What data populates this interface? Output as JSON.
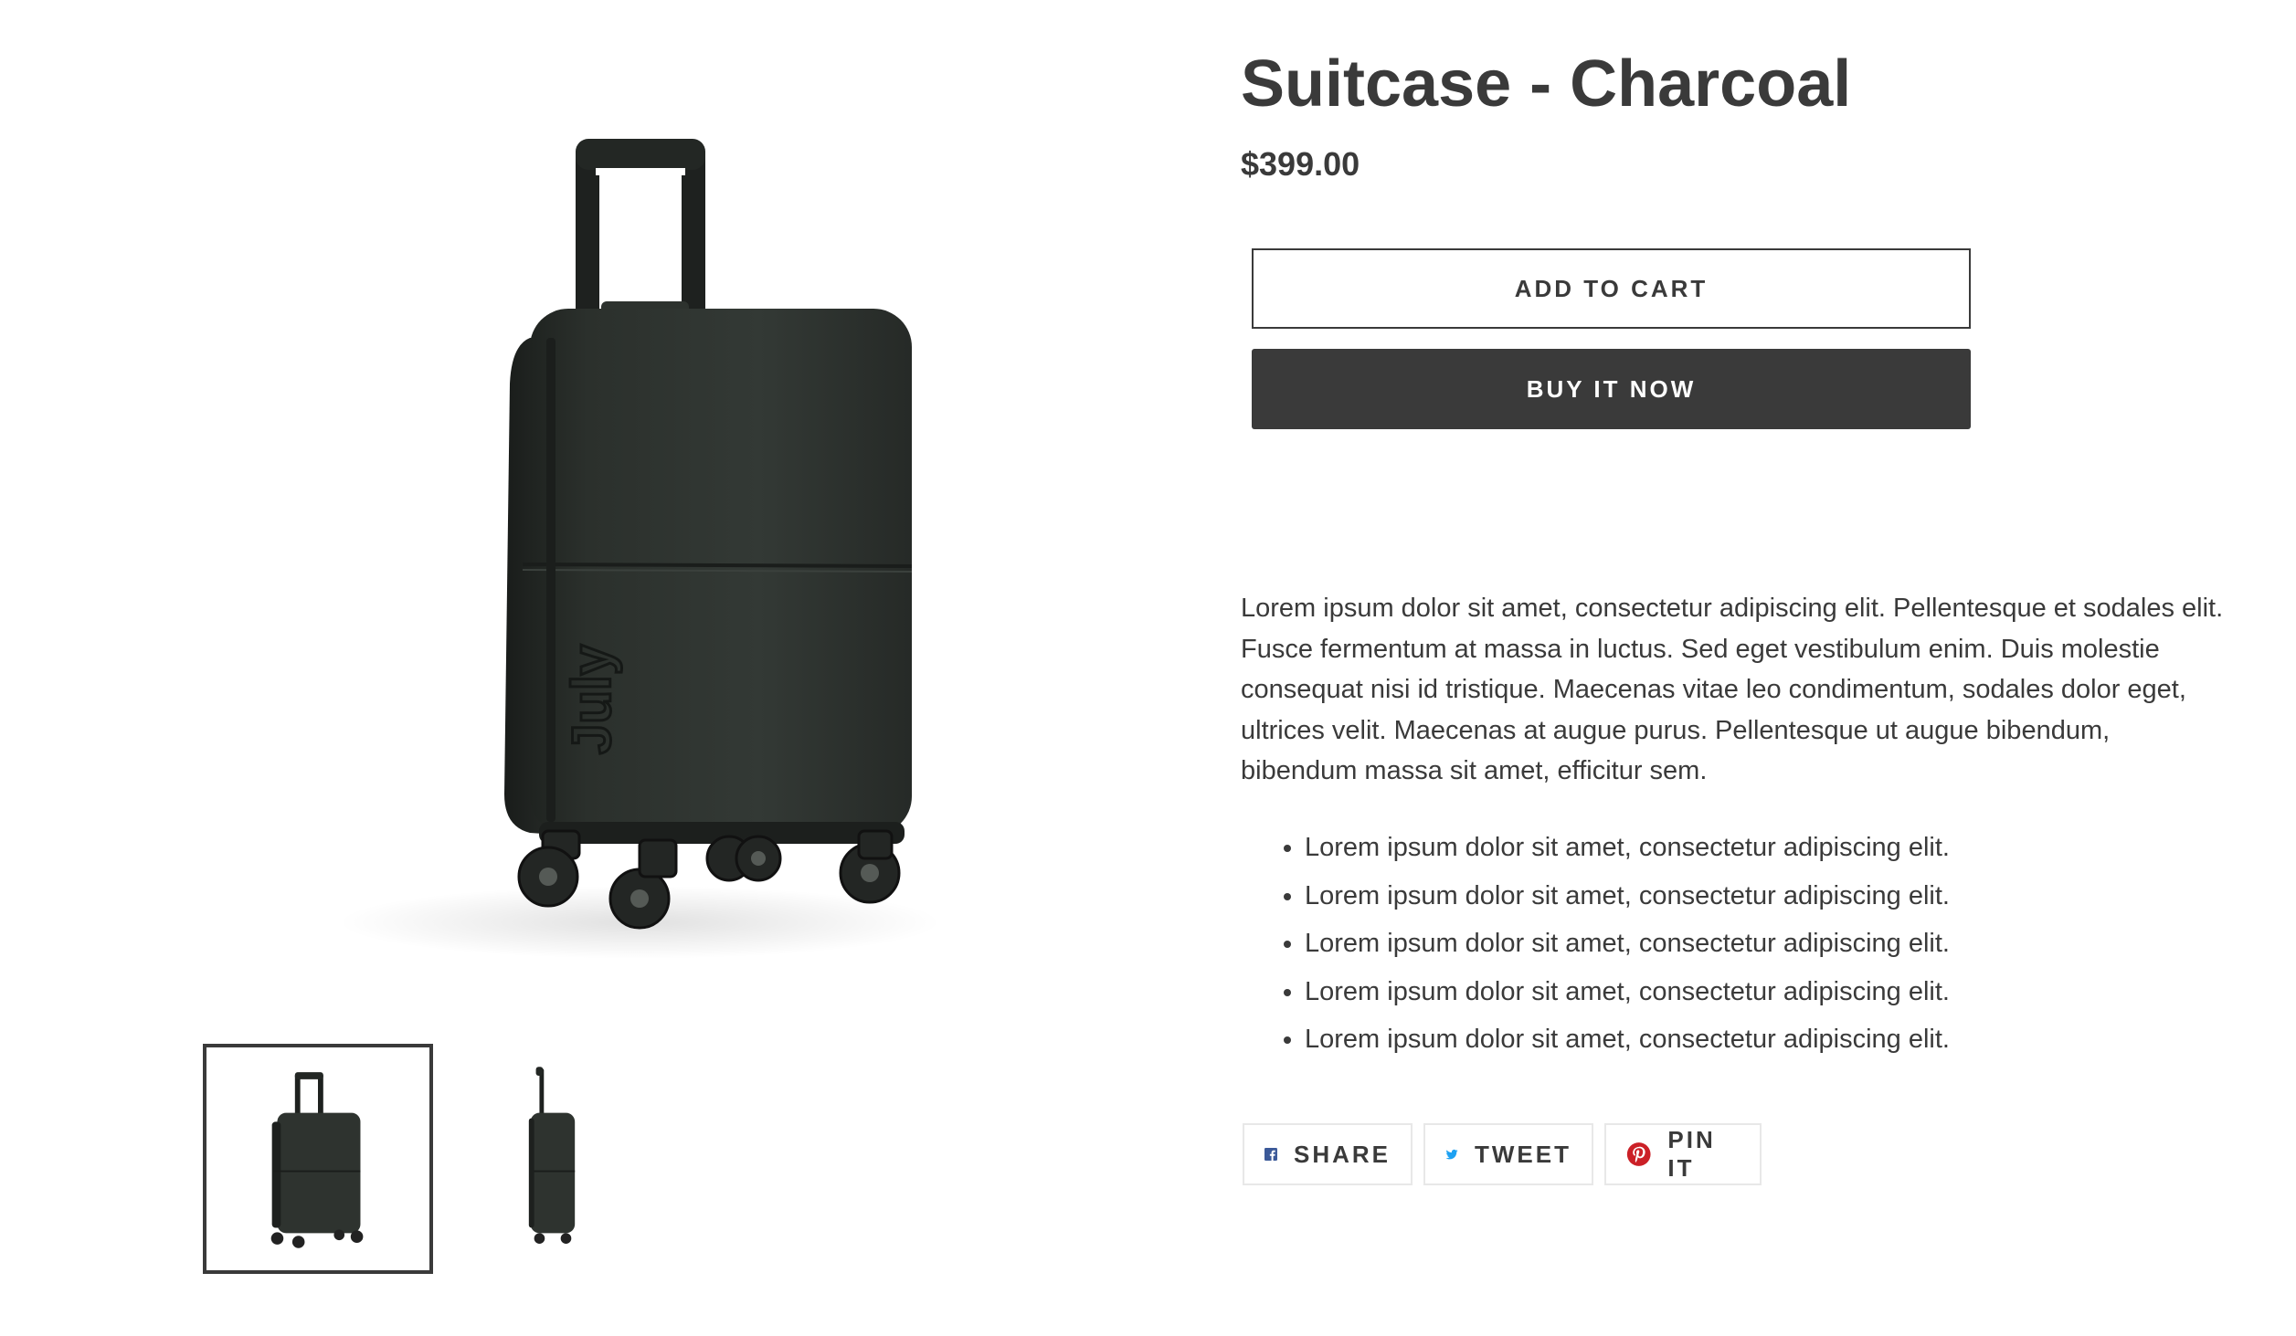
{
  "product": {
    "title": "Suitcase - Charcoal",
    "price": "$399.00",
    "add_to_cart_label": "ADD TO CART",
    "buy_now_label": "BUY IT NOW",
    "description": "Lorem ipsum dolor sit amet, consectetur adipiscing elit. Pellentesque et sodales elit. Fusce fermentum at massa in luctus. Sed eget vestibulum enim. Duis molestie consequat nisi id tristique. Maecenas vitae leo condimentum, sodales dolor eget, ultrices velit. Maecenas at augue purus. Pellentesque ut augue bibendum, bibendum massa sit amet, efficitur sem.",
    "features": [
      "Lorem ipsum dolor sit amet, consectetur adipiscing elit.",
      "Lorem ipsum dolor sit amet, consectetur adipiscing elit.",
      "Lorem ipsum dolor sit amet, consectetur adipiscing elit.",
      "Lorem ipsum dolor sit amet, consectetur adipiscing elit.",
      "Lorem ipsum dolor sit amet, consectetur adipiscing elit."
    ]
  },
  "gallery": {
    "main_image": "suitcase-front-angle-image",
    "thumbnails": [
      {
        "name": "suitcase-front-angle-thumbnail",
        "active": true
      },
      {
        "name": "suitcase-side-thumbnail",
        "active": false
      }
    ]
  },
  "social": {
    "share_label": "SHARE",
    "tweet_label": "TWEET",
    "pin_label": "PIN IT",
    "facebook_icon": "facebook-icon",
    "twitter_icon": "twitter-icon",
    "pinterest_icon": "pinterest-icon",
    "facebook_color": "#3b5998",
    "twitter_color": "#1da1f2",
    "pinterest_color": "#cb2027"
  },
  "colors": {
    "text": "#3a3a3a",
    "button_dark": "#3a3a3a",
    "suitcase": "#2e332f"
  }
}
